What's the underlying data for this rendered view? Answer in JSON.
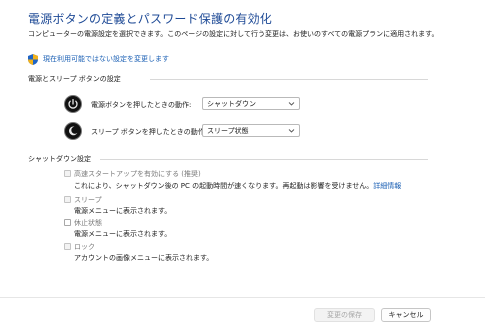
{
  "page": {
    "title": "電源ボタンの定義とパスワード保護の有効化",
    "description": "コンピューターの電源設定を選択できます。このページの設定に対して行う変更は、お使いのすべての電源プランに適用されます。",
    "change_unavailable_link": "現在利用可能ではない設定を変更します"
  },
  "power_buttons": {
    "section_title": "電源とスリープ ボタンの設定",
    "rows": [
      {
        "label": "電源ボタンを押したときの動作:",
        "value": "シャットダウン",
        "icon": "power-icon"
      },
      {
        "label": "スリープ ボタンを押したときの動作:",
        "value": "スリープ状態",
        "icon": "sleep-icon"
      }
    ]
  },
  "shutdown": {
    "section_title": "シャットダウン設定",
    "options": [
      {
        "label": "高速スタートアップを有効にする (推奨)",
        "desc": "これにより、シャットダウン後の PC の起動時間が速くなります。再起動は影響を受けません。",
        "link": "詳細情報",
        "checked": false,
        "disabled": true
      },
      {
        "label": "スリープ",
        "desc": "電源メニューに表示されます。",
        "checked": false,
        "disabled": true
      },
      {
        "label": "休止状態",
        "desc": "電源メニューに表示されます。",
        "checked": false,
        "disabled": false
      },
      {
        "label": "ロック",
        "desc": "アカウントの画像メニューに表示されます。",
        "checked": false,
        "disabled": true
      }
    ]
  },
  "footer": {
    "save_label": "変更の保存",
    "cancel_label": "キャンセル"
  },
  "colors": {
    "title": "#1e4a96",
    "link": "#1a5fb4",
    "disabled_text": "#7a7a7a"
  }
}
